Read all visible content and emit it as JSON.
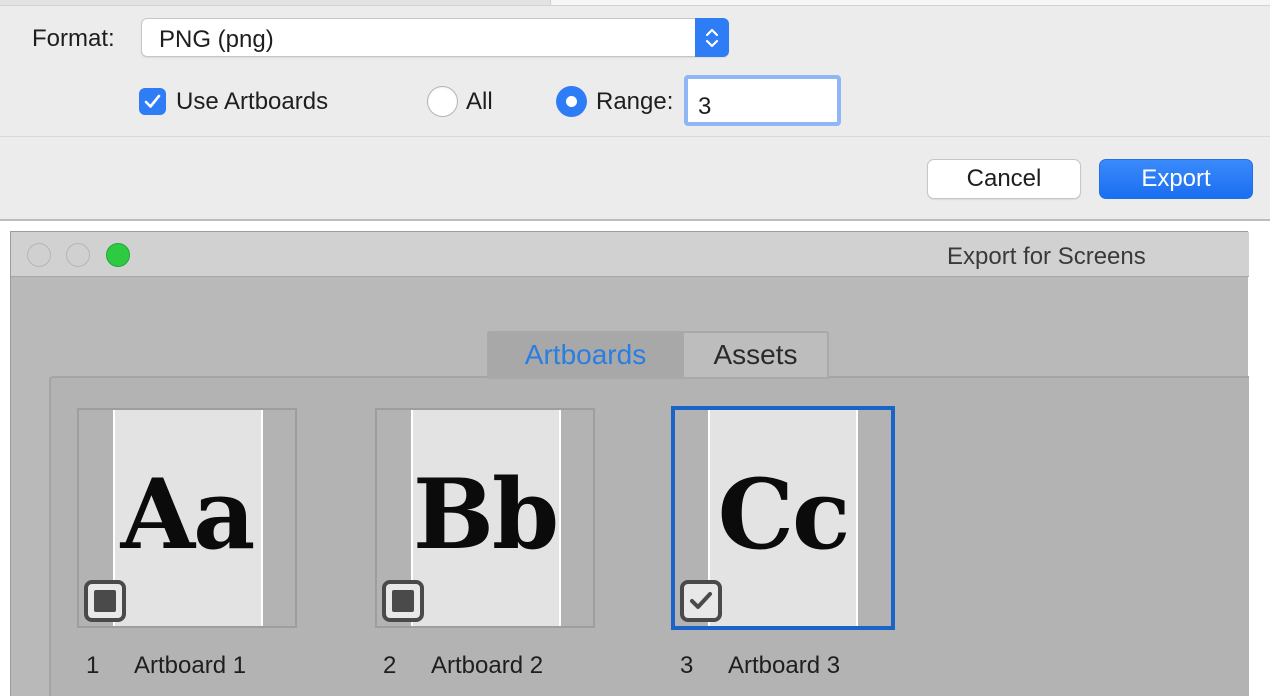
{
  "export_dialog": {
    "format_label": "Format:",
    "format_value": "PNG (png)",
    "use_artboards_label": "Use Artboards",
    "use_artboards_checked": true,
    "radio_all_label": "All",
    "radio_range_label": "Range:",
    "range_value": "3",
    "selected_option": "Range",
    "cancel_label": "Cancel",
    "export_label": "Export"
  },
  "efs_window": {
    "title": "Export for Screens",
    "tabs": [
      {
        "label": "Artboards",
        "active": true
      },
      {
        "label": "Assets",
        "active": false
      }
    ],
    "artboards": [
      {
        "number": "1",
        "name": "Artboard 1",
        "preview_text": "Aa",
        "check_state": "mixed",
        "selected": false
      },
      {
        "number": "2",
        "name": "Artboard 2",
        "preview_text": "Bb",
        "check_state": "mixed",
        "selected": false
      },
      {
        "number": "3",
        "name": "Artboard 3",
        "preview_text": "Cc",
        "check_state": "checked",
        "selected": true
      }
    ]
  },
  "colors": {
    "accent": "#2e7cf6",
    "selection_border": "#1a64c8",
    "tab_active_text": "#2a7de1",
    "zoom_light": "#2ecb42"
  },
  "icons": {
    "format_select": "chevron-up-down-icon",
    "checkbox": "checkmark-icon",
    "artboard_mixed": "mixed-state-icon",
    "artboard_checked": "checkmark-icon"
  }
}
